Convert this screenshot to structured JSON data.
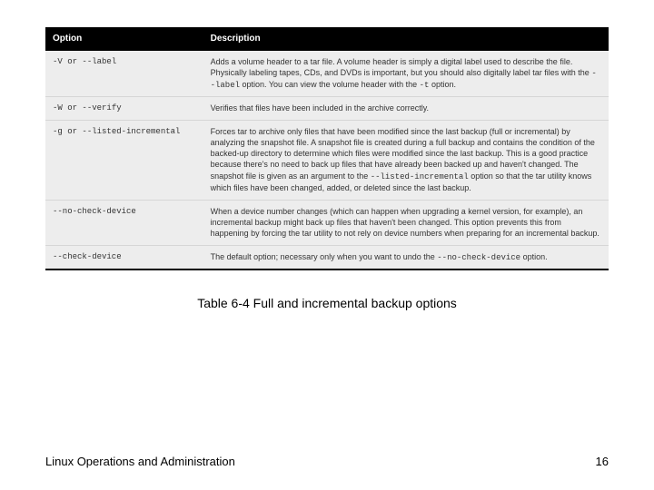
{
  "table": {
    "headers": {
      "option": "Option",
      "description": "Description"
    },
    "rows": [
      {
        "opt_pre": "-V",
        "opt_mid": " or ",
        "opt_post": "--label",
        "desc_a": "Adds a volume header to a tar file. A volume header is simply a digital label used to describe the file. Physically labeling tapes, CDs, and DVDs is important, but you should also digitally label tar files with the ",
        "desc_code1": "--label",
        "desc_b": " option. You can view the volume header with the ",
        "desc_code2": "-t",
        "desc_c": " option."
      },
      {
        "opt_pre": "-W",
        "opt_mid": " or ",
        "opt_post": "--verify",
        "desc_a": "Verifies that files have been included in the archive correctly.",
        "desc_code1": "",
        "desc_b": "",
        "desc_code2": "",
        "desc_c": ""
      },
      {
        "opt_pre": "-g",
        "opt_mid": " or ",
        "opt_post": "--listed-incremental",
        "desc_a": "Forces tar to archive only files that have been modified since the last backup (full or incremental) by analyzing the snapshot file. A snapshot file is created during a full backup and contains the condition of the backed-up directory to determine which files were modified since the last backup. This is a good practice because there's no need to back up files that have already been backed up and haven't changed. The snapshot file is given as an argument to the ",
        "desc_code1": "--listed-incremental",
        "desc_b": " option so that the tar utility knows which files have been changed, added, or deleted since the last backup.",
        "desc_code2": "",
        "desc_c": ""
      },
      {
        "opt_pre": "--no-check-device",
        "opt_mid": "",
        "opt_post": "",
        "desc_a": "When a device number changes (which can happen when upgrading a kernel version, for example), an incremental backup might back up files that haven't been changed. This option prevents this from happening by forcing the tar utility to not rely on device numbers when preparing for an incremental backup.",
        "desc_code1": "",
        "desc_b": "",
        "desc_code2": "",
        "desc_c": ""
      },
      {
        "opt_pre": "--check-device",
        "opt_mid": "",
        "opt_post": "",
        "desc_a": "The default option; necessary only when you want to undo the ",
        "desc_code1": "--no-check-device",
        "desc_b": " option.",
        "desc_code2": "",
        "desc_c": ""
      }
    ]
  },
  "caption": "Table 6-4 Full and incremental backup options",
  "footer": {
    "left": "Linux Operations and Administration",
    "right": "16"
  }
}
